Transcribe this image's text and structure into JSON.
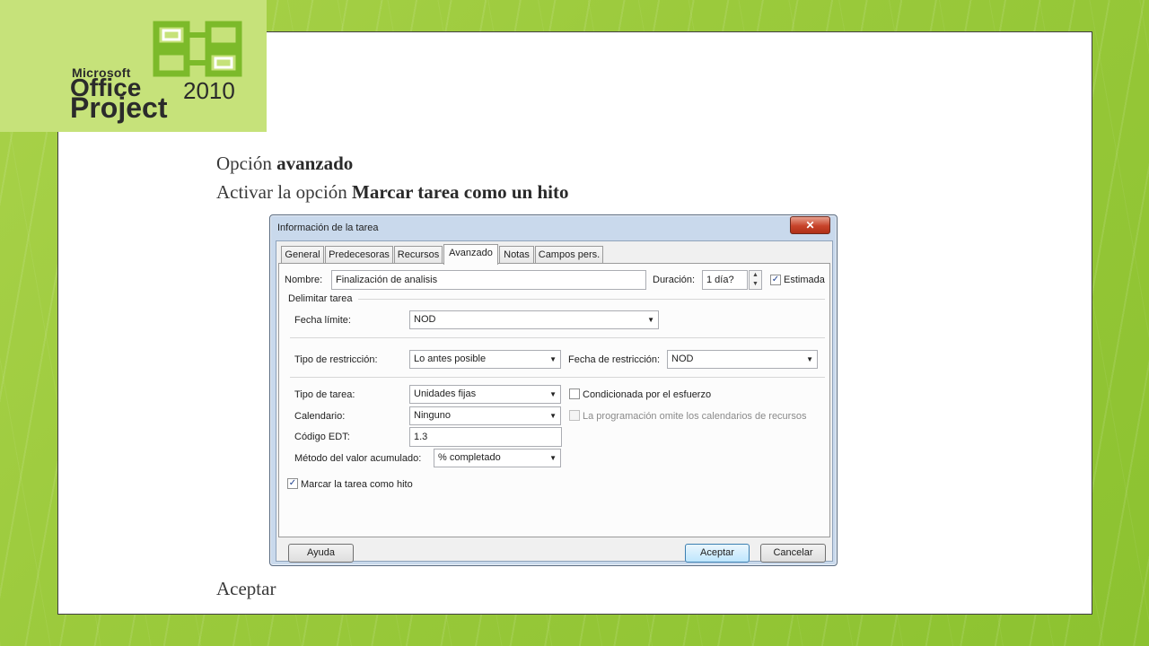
{
  "logo": {
    "brand": "Microsoft",
    "product": "Office",
    "year": "2010",
    "app": "Project"
  },
  "slide": {
    "line1_prefix": "Opción ",
    "line1_bold": "avanzado",
    "line2_prefix": "Activar la opción ",
    "line2_bold": "Marcar tarea como un hito",
    "footer": "Aceptar"
  },
  "dialog": {
    "title": "Información de la tarea",
    "close_glyph": "✕",
    "tabs": [
      {
        "label": "General"
      },
      {
        "label": "Predecesoras"
      },
      {
        "label": "Recursos"
      },
      {
        "label": "Avanzado",
        "active": true
      },
      {
        "label": "Notas"
      },
      {
        "label": "Campos pers."
      }
    ],
    "nombre_label": "Nombre:",
    "nombre_value": "Finalización de analisis",
    "duracion_label": "Duración:",
    "duracion_value": "1 día?",
    "estimada_label": "Estimada",
    "estimada_checked": true,
    "delimitar_label": "Delimitar tarea",
    "fecha_limite_label": "Fecha límite:",
    "fecha_limite_value": "NOD",
    "tipo_restriccion_label": "Tipo de restricción:",
    "tipo_restriccion_value": "Lo antes posible",
    "fecha_restriccion_label": "Fecha de restricción:",
    "fecha_restriccion_value": "NOD",
    "tipo_tarea_label": "Tipo de tarea:",
    "tipo_tarea_value": "Unidades fijas",
    "condicionada_label": "Condicionada por el esfuerzo",
    "condicionada_checked": false,
    "calendario_label": "Calendario:",
    "calendario_value": "Ninguno",
    "omite_label": "La programación omite los calendarios de recursos",
    "omite_checked": false,
    "codigo_edt_label": "Código EDT:",
    "codigo_edt_value": "1.3",
    "metodo_label": "Método del valor acumulado:",
    "metodo_value": "% completado",
    "hito_label": "Marcar la tarea como hito",
    "hito_checked": true,
    "btn_ayuda": "Ayuda",
    "btn_aceptar": "Aceptar",
    "btn_cancelar": "Cancelar",
    "check_glyph": "✓",
    "dropdown_glyph": "▼",
    "spin_up": "▲",
    "spin_down": "▼"
  }
}
